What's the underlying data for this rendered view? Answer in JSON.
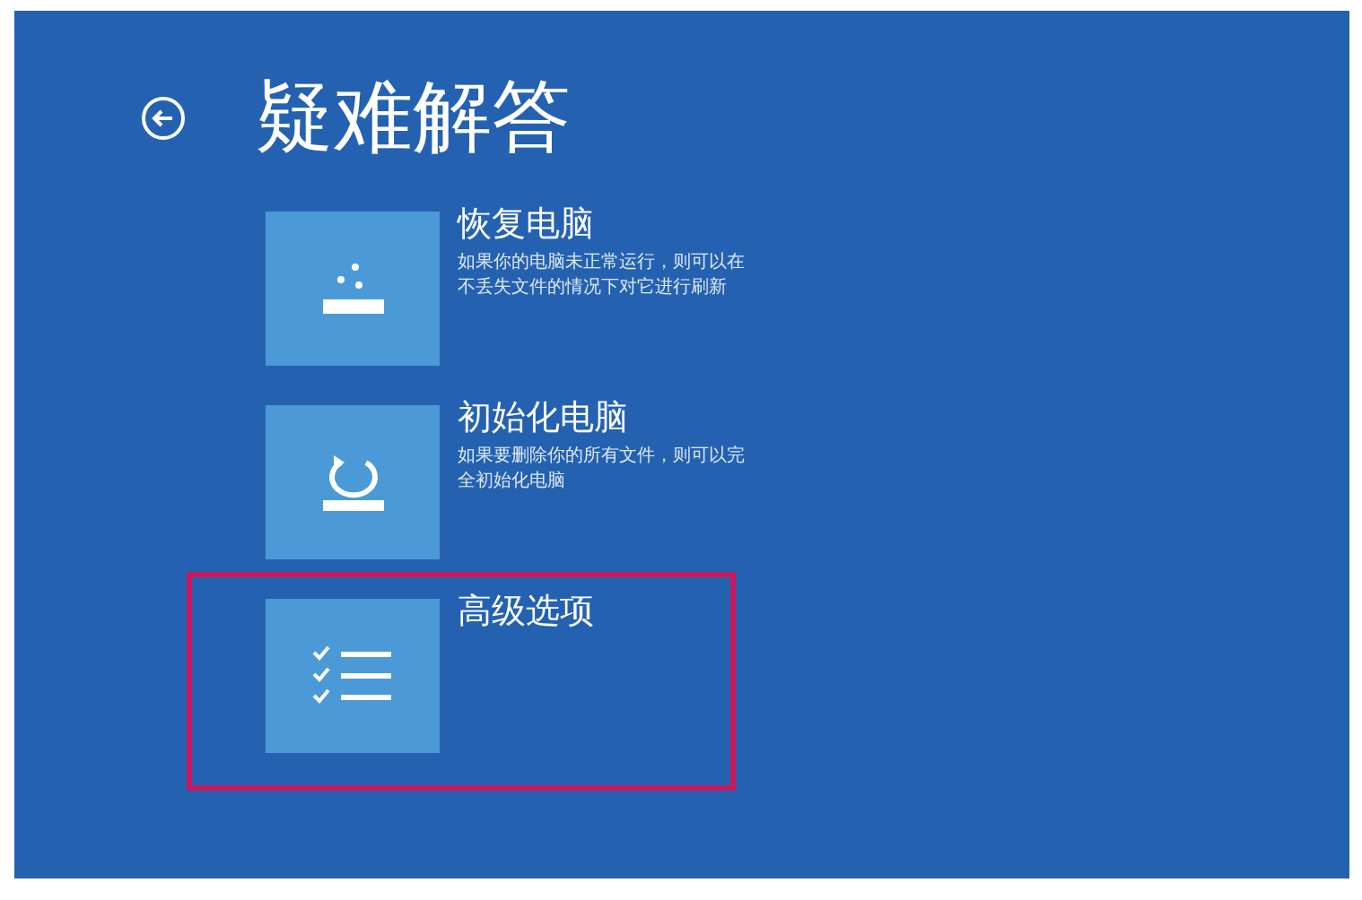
{
  "title": "疑难解答",
  "options": [
    {
      "kind": "refresh",
      "label": "恢复电脑",
      "description": "如果你的电脑未正常运行，则可以在不丢失文件的情况下对它进行刷新",
      "highlighted": false
    },
    {
      "kind": "reset",
      "label": "初始化电脑",
      "description": "如果要删除你的所有文件，则可以完全初始化电脑",
      "highlighted": false
    },
    {
      "kind": "advanced",
      "label": "高级选项",
      "highlighted": true
    }
  ]
}
